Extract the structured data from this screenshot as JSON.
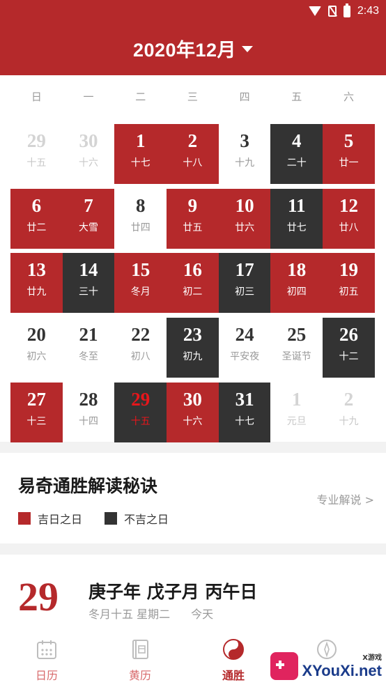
{
  "status": {
    "time": "2:43"
  },
  "header": {
    "title": "2020年12月"
  },
  "weekdays": [
    "日",
    "一",
    "二",
    "三",
    "四",
    "五",
    "六"
  ],
  "weeks": [
    [
      {
        "num": "29",
        "lunar": "十五",
        "type": "faded"
      },
      {
        "num": "30",
        "lunar": "十六",
        "type": "faded"
      },
      {
        "num": "1",
        "lunar": "十七",
        "type": "good"
      },
      {
        "num": "2",
        "lunar": "十八",
        "type": "good"
      },
      {
        "num": "3",
        "lunar": "十九",
        "type": "plain"
      },
      {
        "num": "4",
        "lunar": "二十",
        "type": "bad"
      },
      {
        "num": "5",
        "lunar": "廿一",
        "type": "good"
      }
    ],
    [
      {
        "num": "6",
        "lunar": "廿二",
        "type": "good"
      },
      {
        "num": "7",
        "lunar": "大雪",
        "type": "good"
      },
      {
        "num": "8",
        "lunar": "廿四",
        "type": "plain"
      },
      {
        "num": "9",
        "lunar": "廿五",
        "type": "good"
      },
      {
        "num": "10",
        "lunar": "廿六",
        "type": "good"
      },
      {
        "num": "11",
        "lunar": "廿七",
        "type": "bad"
      },
      {
        "num": "12",
        "lunar": "廿八",
        "type": "good"
      }
    ],
    [
      {
        "num": "13",
        "lunar": "廿九",
        "type": "good"
      },
      {
        "num": "14",
        "lunar": "三十",
        "type": "bad"
      },
      {
        "num": "15",
        "lunar": "冬月",
        "type": "good"
      },
      {
        "num": "16",
        "lunar": "初二",
        "type": "good"
      },
      {
        "num": "17",
        "lunar": "初三",
        "type": "bad"
      },
      {
        "num": "18",
        "lunar": "初四",
        "type": "good"
      },
      {
        "num": "19",
        "lunar": "初五",
        "type": "good"
      }
    ],
    [
      {
        "num": "20",
        "lunar": "初六",
        "type": "plain"
      },
      {
        "num": "21",
        "lunar": "冬至",
        "type": "plain"
      },
      {
        "num": "22",
        "lunar": "初八",
        "type": "plain"
      },
      {
        "num": "23",
        "lunar": "初九",
        "type": "bad"
      },
      {
        "num": "24",
        "lunar": "平安夜",
        "type": "plain"
      },
      {
        "num": "25",
        "lunar": "圣诞节",
        "type": "plain"
      },
      {
        "num": "26",
        "lunar": "十二",
        "type": "bad"
      }
    ],
    [
      {
        "num": "27",
        "lunar": "十三",
        "type": "good"
      },
      {
        "num": "28",
        "lunar": "十四",
        "type": "plain"
      },
      {
        "num": "29",
        "lunar": "十五",
        "type": "bad today"
      },
      {
        "num": "30",
        "lunar": "十六",
        "type": "good"
      },
      {
        "num": "31",
        "lunar": "十七",
        "type": "bad"
      },
      {
        "num": "1",
        "lunar": "元旦",
        "type": "faded"
      },
      {
        "num": "2",
        "lunar": "十九",
        "type": "faded"
      }
    ]
  ],
  "legend": {
    "title": "易奇通胜解读秘诀",
    "link": "专业解说 >",
    "good_label": "吉日之日",
    "bad_label": "不吉之日",
    "good_color": "#b5292b",
    "bad_color": "#333333"
  },
  "detail": {
    "day": "29",
    "ganzhi": "庚子年 戊子月 丙午日",
    "lunar_date": "冬月十五 星期二",
    "today_label": "今天"
  },
  "nav": [
    {
      "label": "日历",
      "icon": "calendar-icon"
    },
    {
      "label": "黄历",
      "icon": "almanac-icon"
    },
    {
      "label": "通胜",
      "icon": "yinyang-icon",
      "active": true
    },
    {
      "label": "",
      "icon": "compass-icon"
    }
  ],
  "watermark": {
    "small": "X游戏",
    "big": "XYouXi.net"
  }
}
